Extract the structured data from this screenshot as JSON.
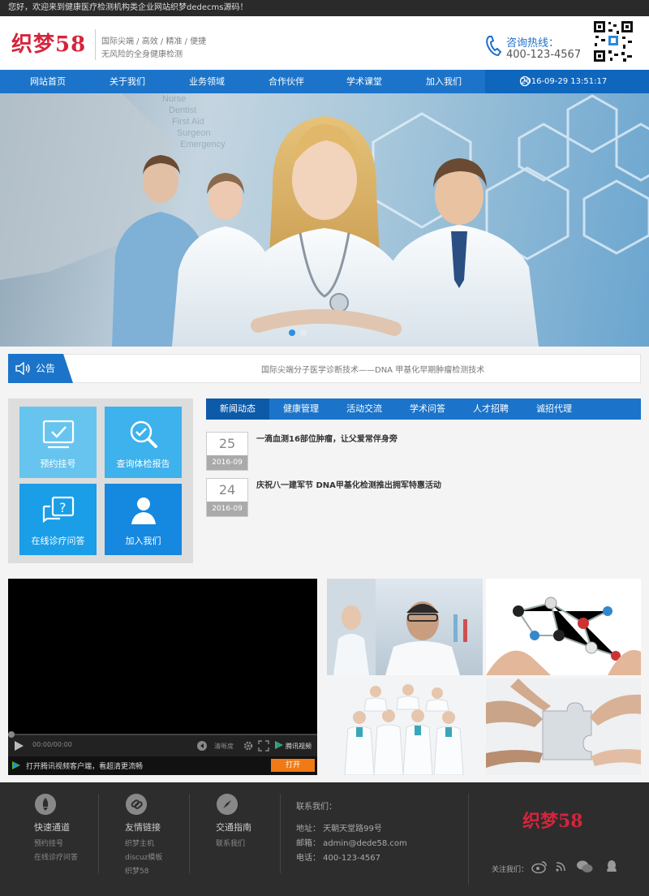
{
  "topbar": {
    "welcome": "您好，欢迎来到健康医疗检测机构类企业网站织梦dedecms源码！"
  },
  "header": {
    "logo": "织梦58",
    "slogan_line1": "国际尖端 / 高效 / 精准 / 便捷",
    "slogan_line2": "无风险的全身健康检测",
    "hotline_label": "咨询热线：",
    "hotline_number": "400-123-4567"
  },
  "nav": {
    "items": [
      "网站首页",
      "关于我们",
      "业务领域",
      "合作伙伴",
      "学术课堂",
      "加入我们"
    ],
    "datetime": "2016-09-29 13:51:17"
  },
  "banner": {
    "slides": 2,
    "active_slide": 1,
    "image_text": [
      "Nurse",
      "Dentist",
      "First Aid",
      "Surgeon",
      "Emergency"
    ]
  },
  "notice": {
    "label": "公告",
    "text": "国际尖端分子医学诊断技术——DNA 甲基化早期肿瘤检测技术"
  },
  "quick_links": [
    "预约挂号",
    "查询体检报告",
    "在线诊疗问答",
    "加入我们"
  ],
  "tabs": [
    "新闻动态",
    "健康管理",
    "活动交流",
    "学术问答",
    "人才招聘",
    "诚招代理"
  ],
  "news": [
    {
      "day": "25",
      "ym": "2016-09",
      "title": "一滴血测16部位肿瘤，让父爱常伴身旁"
    },
    {
      "day": "24",
      "ym": "2016-09",
      "title": "庆祝八一建军节 DNA甲基化检测推出拥军特惠活动"
    }
  ],
  "video": {
    "time": "00:00/00:00",
    "quality": "清晰度",
    "brand": "腾讯视频",
    "client_text": "打开腾讯视频客户端，看超清更流畅",
    "open_button": "打开"
  },
  "footer": {
    "col1": {
      "title": "快速通道",
      "links": [
        "预约挂号",
        "在线诊疗问答"
      ]
    },
    "col2": {
      "title": "友情链接",
      "links": [
        "织梦主机",
        "discuz模板",
        "织梦58"
      ]
    },
    "col3": {
      "title": "交通指南",
      "links": [
        "联系我们"
      ]
    },
    "contact": {
      "title": "联系我们：",
      "address": "地址： 天朝天堂路99号",
      "email": "邮箱： admin@dede58.com",
      "phone": "电话： 400-123-4567"
    },
    "logo": "织梦58",
    "follow": "关注我们："
  },
  "colors": {
    "primary": "#1b74c9",
    "brand_red": "#d4253c",
    "tile_blue": "#1fa0e8",
    "footer_bg": "#2d2d2d"
  }
}
